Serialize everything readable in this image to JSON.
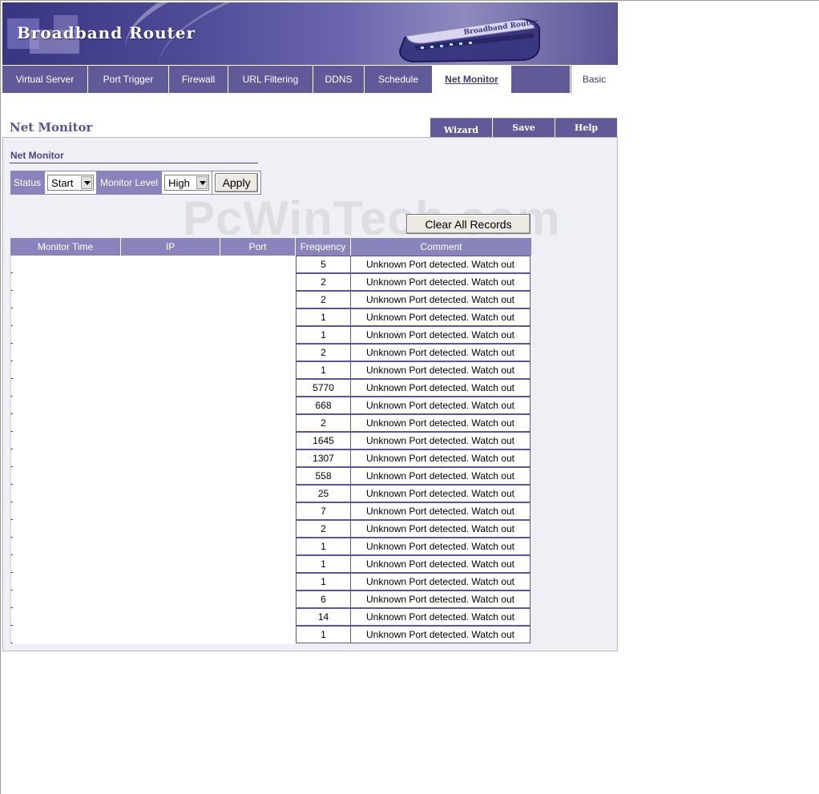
{
  "banner": {
    "title": "Broadband Router"
  },
  "tabs": [
    {
      "label": "Virtual Server"
    },
    {
      "label": "Port Trigger"
    },
    {
      "label": "Firewall"
    },
    {
      "label": "URL Filtering"
    },
    {
      "label": "DDNS"
    },
    {
      "label": "Schedule"
    },
    {
      "label": "Net Monitor",
      "active": true
    },
    {
      "label": ""
    },
    {
      "label": "Basic"
    }
  ],
  "page": {
    "title": "Net Monitor"
  },
  "actions": {
    "wizard": "Wizard",
    "save": "Save",
    "help": "Help"
  },
  "section": {
    "title": "Net Monitor"
  },
  "controls": {
    "status_label": "Status",
    "status_value": "Start",
    "level_label": "Monitor Level",
    "level_value": "High",
    "apply_label": "Apply"
  },
  "clear_label": "Clear All Records",
  "watermark": "PcWinTech.com",
  "table": {
    "headers": [
      "Monitor Time",
      "IP",
      "Port",
      "Frequency",
      "Comment"
    ],
    "rows": [
      {
        "frequency": "5",
        "comment": "Unknown Port detected. Watch out"
      },
      {
        "frequency": "2",
        "comment": "Unknown Port detected. Watch out"
      },
      {
        "frequency": "2",
        "comment": "Unknown Port detected. Watch out"
      },
      {
        "frequency": "1",
        "comment": "Unknown Port detected. Watch out"
      },
      {
        "frequency": "1",
        "comment": "Unknown Port detected. Watch out"
      },
      {
        "frequency": "2",
        "comment": "Unknown Port detected. Watch out"
      },
      {
        "frequency": "1",
        "comment": "Unknown Port detected. Watch out"
      },
      {
        "frequency": "5770",
        "comment": "Unknown Port detected. Watch out"
      },
      {
        "frequency": "668",
        "comment": "Unknown Port detected. Watch out"
      },
      {
        "frequency": "2",
        "comment": "Unknown Port detected. Watch out"
      },
      {
        "frequency": "1645",
        "comment": "Unknown Port detected. Watch out"
      },
      {
        "frequency": "1307",
        "comment": "Unknown Port detected. Watch out"
      },
      {
        "frequency": "558",
        "comment": "Unknown Port detected. Watch out"
      },
      {
        "frequency": "25",
        "comment": "Unknown Port detected. Watch out"
      },
      {
        "frequency": "7",
        "comment": "Unknown Port detected. Watch out"
      },
      {
        "frequency": "2",
        "comment": "Unknown Port detected. Watch out"
      },
      {
        "frequency": "1",
        "comment": "Unknown Port detected. Watch out"
      },
      {
        "frequency": "1",
        "comment": "Unknown Port detected. Watch out"
      },
      {
        "frequency": "1",
        "comment": "Unknown Port detected. Watch out"
      },
      {
        "frequency": "6",
        "comment": "Unknown Port detected. Watch out"
      },
      {
        "frequency": "14",
        "comment": "Unknown Port detected. Watch out"
      },
      {
        "frequency": "1",
        "comment": "Unknown Port detected. Watch out"
      }
    ]
  }
}
